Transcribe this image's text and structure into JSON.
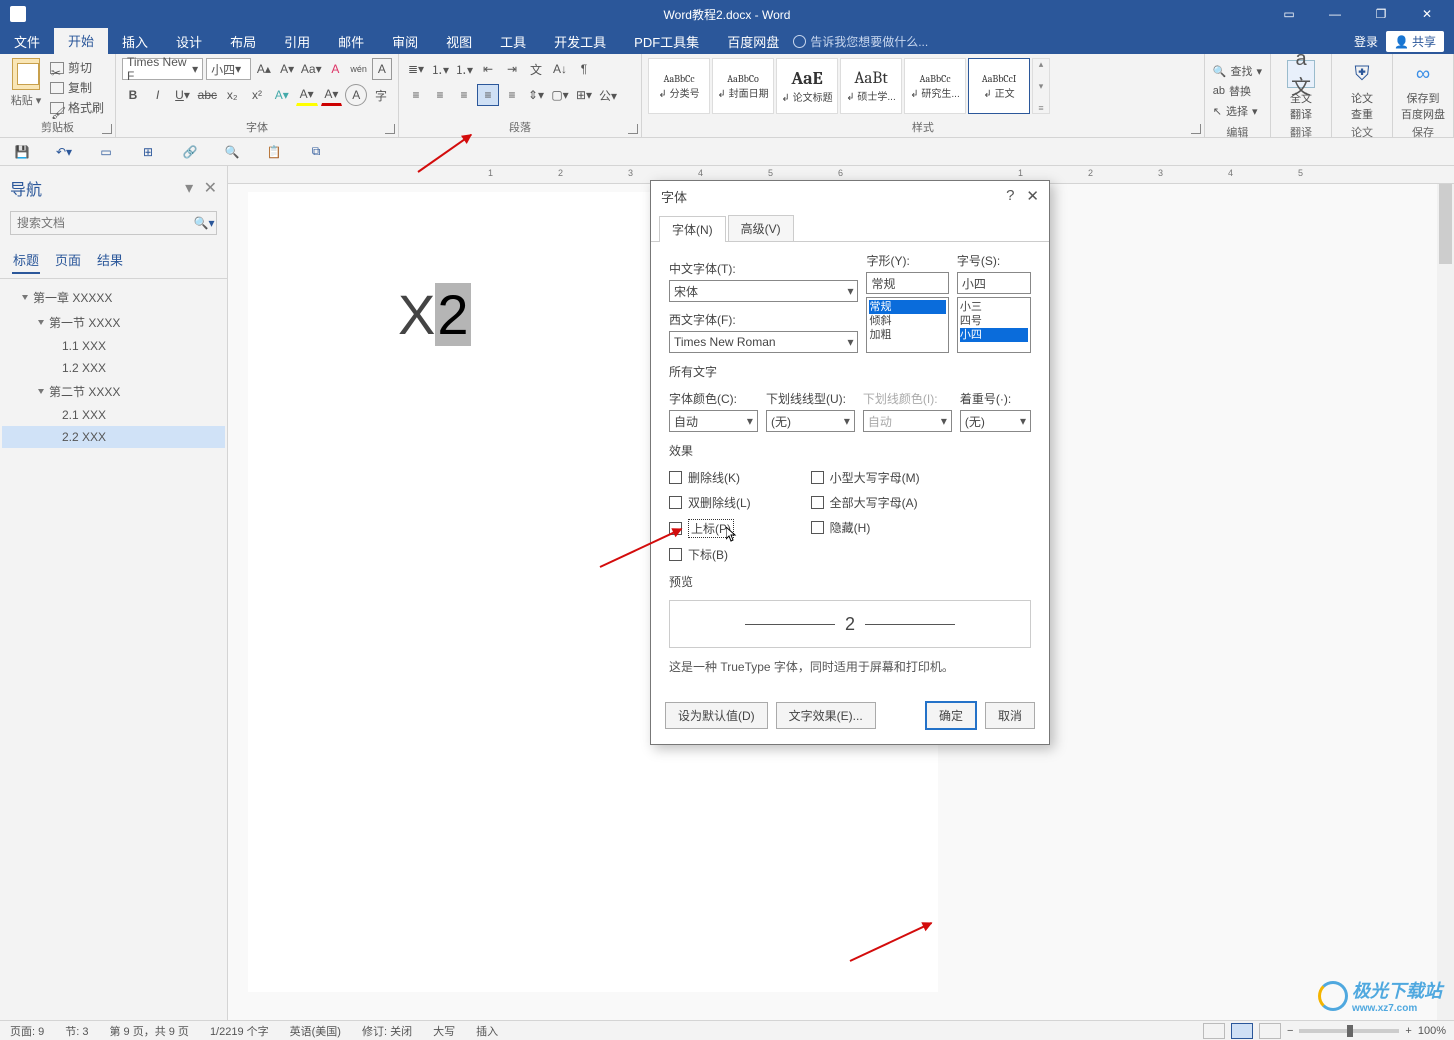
{
  "title": "Word教程2.docx - Word",
  "menu": {
    "tabs": [
      "文件",
      "开始",
      "插入",
      "设计",
      "布局",
      "引用",
      "邮件",
      "审阅",
      "视图",
      "工具",
      "开发工具",
      "PDF工具集",
      "百度网盘"
    ],
    "activeIndex": 1,
    "tellme": "告诉我您想要做什么...",
    "login": "登录",
    "share": "共享"
  },
  "ribbon": {
    "clipboard": {
      "label": "剪贴板",
      "paste": "粘贴",
      "cut": "剪切",
      "copy": "复制",
      "formatPainter": "格式刷"
    },
    "font": {
      "label": "字体",
      "fontName": "Times New F",
      "fontSize": "小四"
    },
    "paragraph": {
      "label": "段落"
    },
    "styles": {
      "label": "样式",
      "items": [
        {
          "preview": "AaBbCc",
          "name": "↲ 分类号"
        },
        {
          "preview": "AaBbCo",
          "name": "↲ 封面日期"
        },
        {
          "preview": "AaE",
          "name": "↲ 论文标题",
          "big": true
        },
        {
          "preview": "AaBt",
          "name": "↲ 硕士学...",
          "big": true
        },
        {
          "preview": "AaBbCc",
          "name": "↲ 研究生..."
        },
        {
          "preview": "AaBbCcI",
          "name": "↲ 正文",
          "normal": true
        }
      ]
    },
    "editing": {
      "label": "编辑",
      "find": "查找",
      "replace": "替换",
      "select": "选择"
    },
    "extra": {
      "translate": {
        "l1": "全文",
        "l2": "翻译",
        "g": "翻译"
      },
      "similarity": {
        "l1": "论文",
        "l2": "查重",
        "g": "论文"
      },
      "baidu": {
        "l1": "保存到",
        "l2": "百度网盘",
        "g": "保存"
      }
    }
  },
  "nav": {
    "title": "导航",
    "searchPlaceholder": "搜索文档",
    "tabs": [
      "标题",
      "页面",
      "结果"
    ],
    "activeTab": 0,
    "tree": [
      {
        "text": "第一章 XXXXX",
        "lvl": 1,
        "exp": true
      },
      {
        "text": "第一节 XXXX",
        "lvl": 2,
        "exp": true
      },
      {
        "text": "1.1 XXX",
        "lvl": 3
      },
      {
        "text": "1.2 XXX",
        "lvl": 3
      },
      {
        "text": "第二节 XXXX",
        "lvl": 2,
        "exp": true
      },
      {
        "text": "2.1 XXX",
        "lvl": 3
      },
      {
        "text": "2.2 XXX",
        "lvl": 3,
        "sel": true
      }
    ]
  },
  "doc": {
    "line1_plain": "X",
    "line1_sel": "2"
  },
  "dialog": {
    "title": "字体",
    "help": "?",
    "close": "✕",
    "tab_font": "字体(N)",
    "tab_adv": "高级(V)",
    "cn_label": "中文字体(T):",
    "cn_val": "宋体",
    "style_label": "字形(Y):",
    "style_val": "常规",
    "style_opts": [
      "常规",
      "倾斜",
      "加粗"
    ],
    "size_label": "字号(S):",
    "size_val": "小四",
    "size_opts": [
      "小三",
      "四号",
      "小四"
    ],
    "en_label": "西文字体(F):",
    "en_val": "Times New Roman",
    "allchar": "所有文字",
    "color_label": "字体颜色(C):",
    "color_val": "自动",
    "ul_label": "下划线线型(U):",
    "ul_val": "(无)",
    "ulcolor_label": "下划线颜色(I):",
    "ulcolor_val": "自动",
    "em_label": "着重号(·):",
    "em_val": "(无)",
    "effects": "效果",
    "chk_strike": "删除线(K)",
    "chk_dstrike": "双删除线(L)",
    "chk_super": "上标(P)",
    "chk_sub": "下标(B)",
    "chk_smallcaps": "小型大写字母(M)",
    "chk_allcaps": "全部大写字母(A)",
    "chk_hidden": "隐藏(H)",
    "preview": "预览",
    "preview_val": "2",
    "note": "这是一种 TrueType 字体，同时适用于屏幕和打印机。",
    "btn_default": "设为默认值(D)",
    "btn_texteffect": "文字效果(E)...",
    "btn_ok": "确定",
    "btn_cancel": "取消"
  },
  "status": {
    "page": "页面: 9",
    "section": "节: 3",
    "pageof": "第 9 页，共 9 页",
    "words": "1/2219 个字",
    "lang": "英语(美国)",
    "track": "修订: 关闭",
    "caps": "大写",
    "insert": "插入",
    "zoom": "100%"
  },
  "watermark": {
    "name": "极光下载站",
    "url": "www.xz7.com"
  },
  "ruler_marks": [
    "1",
    "2",
    "3",
    "4",
    "5",
    "6",
    "1",
    "2",
    "3",
    "4",
    "5"
  ]
}
